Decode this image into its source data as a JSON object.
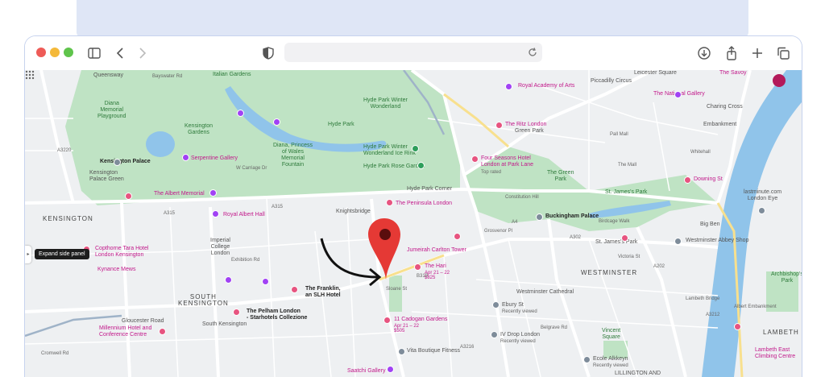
{
  "colors": {
    "accent": "#c2188a",
    "pin": "#e53935",
    "park": "#bfe3c4",
    "water": "#90c4ea",
    "road": "#ffffff",
    "avatar": "#b3195a"
  },
  "browser": {
    "address": "",
    "icons": [
      "sidebar-icon",
      "back-icon",
      "forward-icon",
      "shield-icon",
      "reload-icon",
      "download-icon",
      "share-icon",
      "new-tab-icon",
      "tabs-icon"
    ]
  },
  "map": {
    "tooltip": "Expand side panel",
    "side_tab": "▸",
    "districts": {
      "kensington": "KENSINGTON",
      "south_kensington": "SOUTH\nKENSINGTON",
      "westminster": "WESTMINSTER",
      "lambeth": "LAMBETH",
      "lilington": "LILLINGTON AND"
    },
    "parks": {
      "italian_gardens": "Italian Gardens",
      "diana_memorial": "Diana\nMemorial\nPlayground",
      "kensington_gardens": "Kensington\nGardens",
      "hyde_park": "Hyde Park",
      "diana_fountain": "Diana, Princess\nof Wales\nMemorial\nFountain",
      "hyde_park_rose": "Hyde Park Rose Garden",
      "green_park": "The Green\nPark",
      "st_james_park": "St. James's Park",
      "green_park_stn": "Green Park",
      "vincent_square": "Vincent\nSquare",
      "archbishops_park": "Archbishop's\nPark"
    },
    "places": {
      "queensway": "Queensway",
      "bayswater": "Bayswater Rd",
      "kensington_palace": "Kensington Palace",
      "kensington_palace_green": "Kensington\nPalace Green",
      "serpentine": "Serpentine Gallery",
      "albert_memorial": "The Albert Memorial",
      "royal_albert_hall": "Royal Albert Hall",
      "imperial_college": "Imperial\nCollege\nLondon",
      "copthorne": "Copthorne Tara Hotel\nLondon Kensington",
      "kynance": "Kynance Mews",
      "franklin": "The Franklin,\nan SLH Hotel",
      "pelham": "The Pelham London\n- Starhotels Collezione",
      "millennium": "Millennium Hotel and\nConference Centre",
      "gloucester_road": "Gloucester Road",
      "south_ken_stn": "South Kensington",
      "winter_wonderland": "Hyde Park Winter\nWonderland",
      "ice_rink": "Hyde Park Winter\nWonderland Ice Rink",
      "hyde_park_corner": "Hyde Park Corner",
      "peninsula": "The Peninsula London",
      "knightsbridge": "Knightsbridge",
      "jumeirah": "Jumeirah Carlton Tower",
      "the_hari": "The Hari",
      "the_hari_dates": "Apr 21 – 22\n$825",
      "cadogan": "11 Cadogan Gardens",
      "cadogan_dates": "Apr 21 – 22\n$505",
      "vita": "Vita Boutique Fitness",
      "saatchi": "Saatchi Gallery",
      "ebury": "Ebury St",
      "ebury_sub": "Recently viewed",
      "iv_drop": "IV Drop London",
      "iv_drop_sub": "Recently viewed",
      "ecole": "Ecole Alkkeyn",
      "ecole_sub": "Recently viewed",
      "westminster_cathedral": "Westminster Cathedral",
      "royal_academy": "Royal Academy of Arts",
      "ritz": "The Ritz London",
      "four_seasons": "Four Seasons Hotel\nLondon at Park Lane",
      "four_seasons_sub": "Top rated",
      "piccadilly": "Piccadilly Circus",
      "leicester": "Leicester Square",
      "national_gallery": "The National Gallery",
      "savoy": "The Savoy",
      "charing_cross": "Charing Cross",
      "embankment": "Embankment",
      "downing": "Downing St",
      "big_ben": "Big Ben",
      "london_eye": "lastminute.com\nLondon Eye",
      "buckingham": "Buckingham Palace",
      "st_james_stn": "St. James's Park",
      "westminster_abbey": "Westminster Abbey Shop",
      "constitution": "Constitution Hill",
      "birdcage": "Birdcage Walk",
      "the_mall": "The Mall",
      "pall_mall": "Pall Mall",
      "lambeth_bridge": "Lambeth Bridge",
      "lambeth_east": "Lambeth East\nClimbing Centre",
      "n_embankment": "Albert Embankment"
    },
    "roads": {
      "a315": "A315",
      "a315b": "A315",
      "b319": "B319",
      "a4": "A4",
      "a3216": "A3216",
      "a3220": "A3220",
      "a202": "A202",
      "a302": "A302",
      "a3212": "A3212",
      "exhibition": "Exhibition Rd",
      "w_carriage": "W Carriage Dr",
      "sloane": "Sloane St",
      "cromwell": "Cromwell Rd",
      "victoria": "Victoria St",
      "grosvenor": "Grosvenor Pl",
      "whitehall": "Whitehall",
      "belgrave": "Belgrave Rd"
    }
  }
}
